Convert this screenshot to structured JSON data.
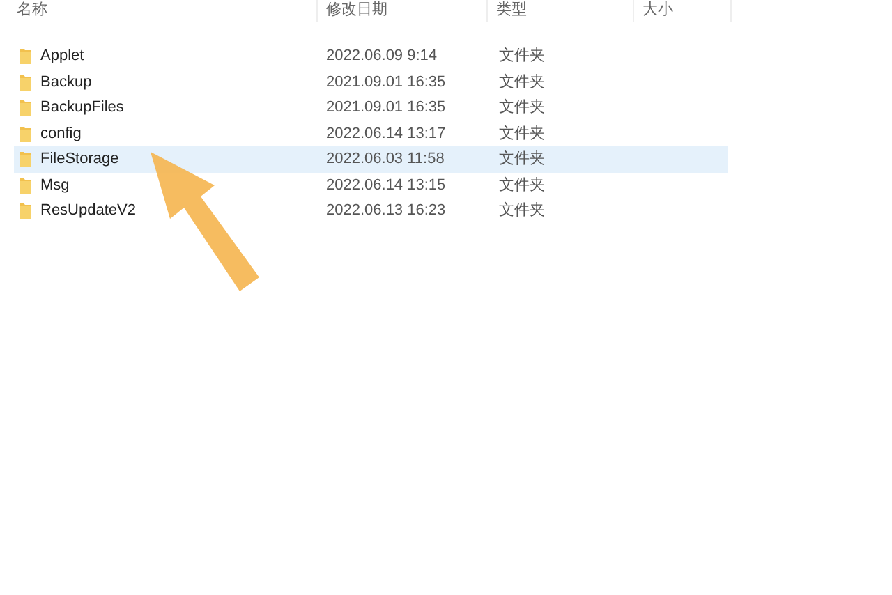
{
  "columns": [
    "名称",
    "修改日期",
    "类型",
    "大小"
  ],
  "rows": [
    {
      "name": "Applet",
      "modified": "2022.06.09 9:14",
      "type": "文件夹",
      "selected": false
    },
    {
      "name": "Backup",
      "modified": "2021.09.01 16:35",
      "type": "文件夹",
      "selected": false
    },
    {
      "name": "BackupFiles",
      "modified": "2021.09.01 16:35",
      "type": "文件夹",
      "selected": false
    },
    {
      "name": "config",
      "modified": "2022.06.14 13:17",
      "type": "文件夹",
      "selected": false
    },
    {
      "name": "FileStorage",
      "modified": "2022.06.03 11:58",
      "type": "文件夹",
      "selected": true
    },
    {
      "name": "Msg",
      "modified": "2022.06.14 13:15",
      "type": "文件夹",
      "selected": false
    },
    {
      "name": "ResUpdateV2",
      "modified": "2022.06.13 16:23",
      "type": "文件夹",
      "selected": false
    }
  ]
}
